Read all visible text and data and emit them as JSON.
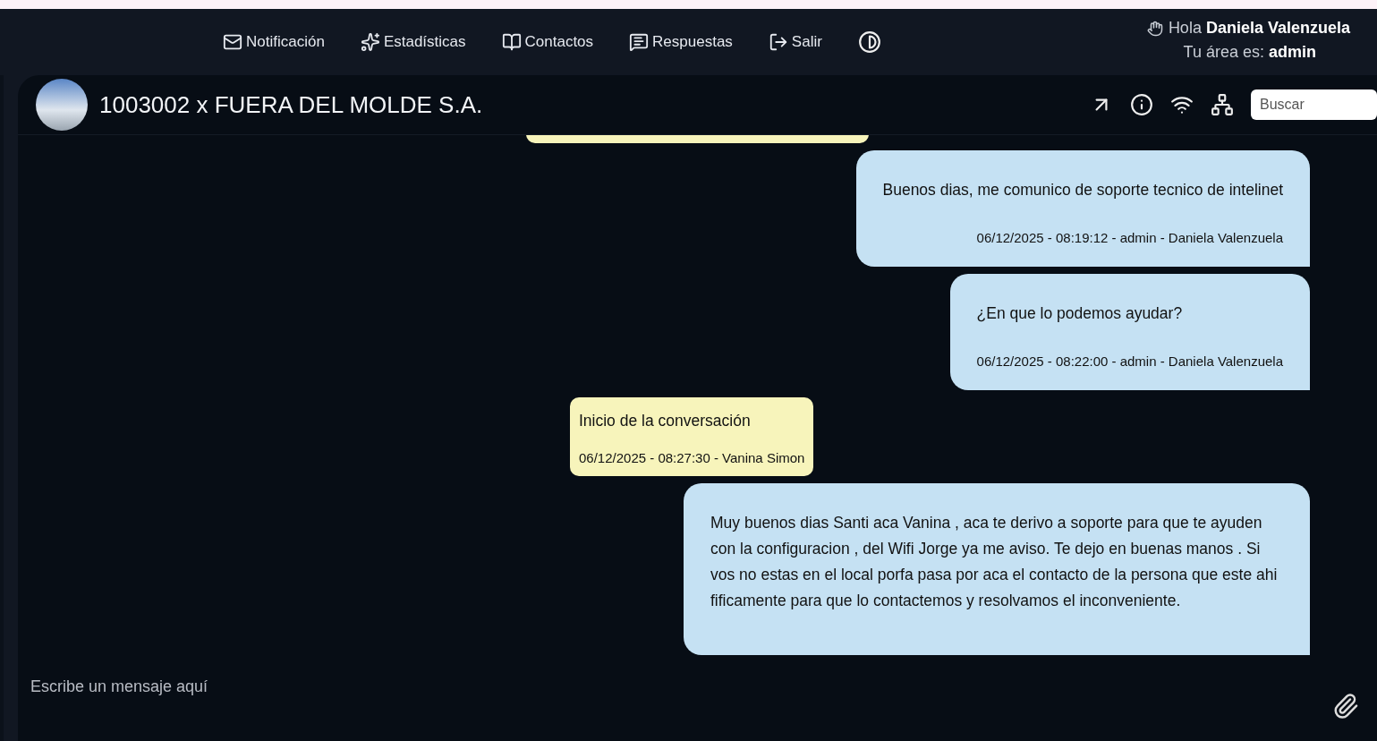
{
  "nav": {
    "items": [
      {
        "label": "Notificación",
        "kind": "mail"
      },
      {
        "label": "Estadísticas",
        "kind": "chart"
      },
      {
        "label": "Contactos",
        "kind": "book"
      },
      {
        "label": "Respuestas",
        "kind": "list"
      },
      {
        "label": "Salir",
        "kind": "exit"
      }
    ],
    "greeting": {
      "prefix": "Hola",
      "name": "Daniela Valenzuela",
      "area_label": "Tu área es:",
      "area": "admin"
    }
  },
  "chat": {
    "title": "1003002 x FUERA DEL MOLDE S.A.",
    "search": {
      "placeholder": "Buscar"
    },
    "messages": [
      {
        "kind": "contact",
        "clipped": true
      },
      {
        "kind": "agent",
        "text": "Buenos dias, me comunico de soporte tecnico de intelinet",
        "meta": "06/12/2025 - 08:19:12 - admin - Daniela Valenzuela",
        "clipped": false
      },
      {
        "kind": "agent",
        "text": "¿En que lo podemos ayudar?",
        "meta": "06/12/2025 - 08:22:00 - admin - Daniela Valenzuela",
        "clipped": false
      },
      {
        "kind": "contact",
        "text": "Inicio de la conversación",
        "meta": "06/12/2025 - 08:27:30 - Vanina Simon",
        "clipped": false
      },
      {
        "kind": "agent",
        "text": "Muy buenos dias Santi aca Vanina , aca te derivo a soporte para que te ayuden con la configuracion , del Wifi Jorge ya me aviso. Te dejo en buenas manos . Si vos no estas en el local porfa pasa por aca el contacto de la persona que este ahi fificamente para que lo contactemos y resolvamos el inconveniente.",
        "clipped": true
      }
    ],
    "composer": {
      "placeholder": "Escribe un mensaje aquí"
    }
  }
}
